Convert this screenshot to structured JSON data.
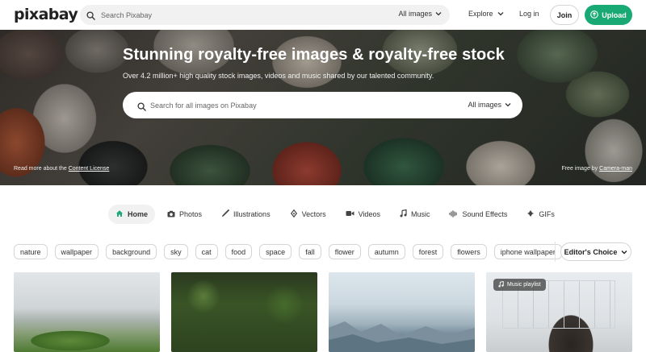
{
  "header": {
    "logo": "pixabay",
    "search_placeholder": "Search Pixabay",
    "search_filter": "All images",
    "explore": "Explore",
    "login": "Log in",
    "join": "Join",
    "upload": "Upload"
  },
  "hero": {
    "title": "Stunning royalty-free images & royalty-free stock",
    "subtitle": "Over 4.2 million+ high quality stock images, videos and music shared by our talented community.",
    "search_placeholder": "Search for all images on Pixabay",
    "search_filter": "All images",
    "license_prefix": "Read more about the",
    "license_link": "Content License",
    "credit_prefix": "Free image by",
    "credit_link": "Camera-man"
  },
  "categories": [
    {
      "label": "Home",
      "icon": "home-icon",
      "active": true
    },
    {
      "label": "Photos",
      "icon": "camera-icon"
    },
    {
      "label": "Illustrations",
      "icon": "brush-icon"
    },
    {
      "label": "Vectors",
      "icon": "pen-nib-icon"
    },
    {
      "label": "Videos",
      "icon": "video-camera-icon"
    },
    {
      "label": "Music",
      "icon": "music-note-icon"
    },
    {
      "label": "Sound Effects",
      "icon": "waveform-icon"
    },
    {
      "label": "GIFs",
      "icon": "gif-icon"
    }
  ],
  "tags": [
    "nature",
    "wallpaper",
    "background",
    "sky",
    "cat",
    "food",
    "space",
    "fall",
    "flower",
    "autumn",
    "forest",
    "flowers",
    "iphone wallpaper"
  ],
  "sort": {
    "label": "Editor's Choice"
  },
  "thumbnails": {
    "playlist_badge": "Music playlist"
  },
  "colors": {
    "accent": "#19a974",
    "text": "#333333",
    "search_bg": "#f1f1f1"
  }
}
